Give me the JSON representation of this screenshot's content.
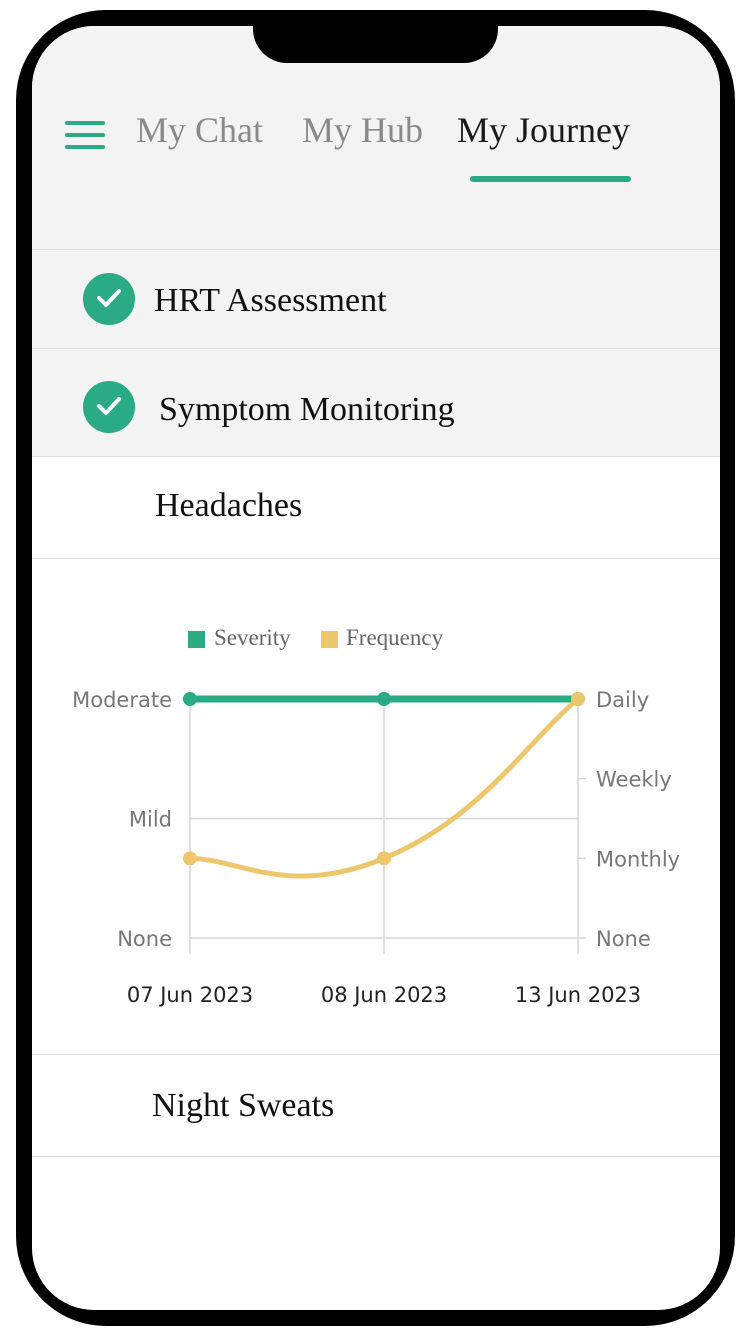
{
  "tabs": [
    {
      "label": "My Chat",
      "active": false
    },
    {
      "label": "My Hub",
      "active": false
    },
    {
      "label": "My Journey",
      "active": true
    }
  ],
  "sections": [
    {
      "label": "HRT Assessment",
      "completed": true
    },
    {
      "label": "Symptom Monitoring",
      "completed": true
    }
  ],
  "symptoms": [
    {
      "label": "Headaches",
      "expanded": true
    },
    {
      "label": "Night Sweats",
      "expanded": false
    }
  ],
  "colors": {
    "accent": "#2baa86",
    "severity": "#2baa86",
    "frequency": "#eec76d"
  },
  "icons": {
    "menu": "hamburger-menu-icon",
    "check": "check-circle-icon"
  },
  "chart_data": {
    "type": "line",
    "categories": [
      "07 Jun 2023",
      "08 Jun 2023",
      "13 Jun 2023"
    ],
    "legend": [
      "Severity",
      "Frequency"
    ],
    "legend_position": "top",
    "grid": true,
    "left_axis": {
      "ticks": [
        "None",
        "Mild",
        "Moderate"
      ],
      "range": [
        0,
        2
      ]
    },
    "right_axis": {
      "ticks": [
        "None",
        "Monthly",
        "Weekly",
        "Daily"
      ],
      "range": [
        0,
        3
      ]
    },
    "series": [
      {
        "name": "Severity",
        "axis": "left",
        "values": [
          2,
          2,
          2
        ],
        "color": "#2baa86",
        "smooth": false
      },
      {
        "name": "Frequency",
        "axis": "right",
        "values": [
          1,
          1,
          3
        ],
        "color": "#eec76d",
        "smooth": true
      }
    ]
  }
}
